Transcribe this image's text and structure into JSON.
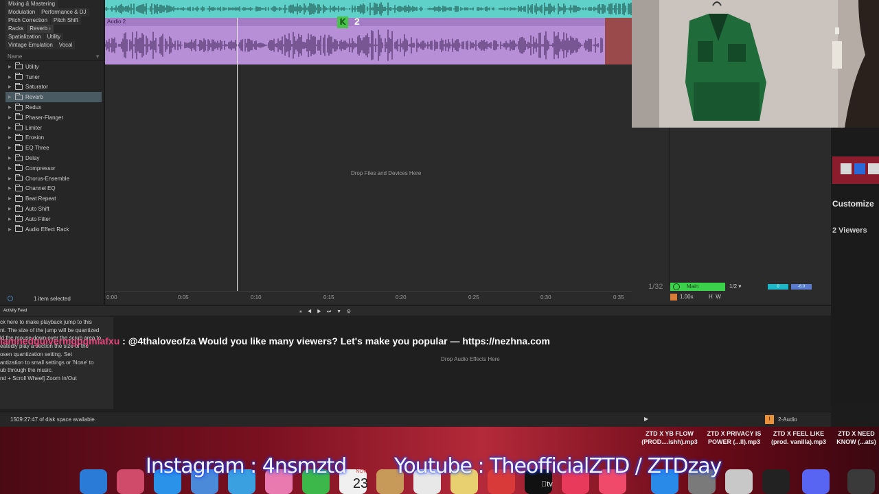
{
  "browser": {
    "tags": [
      [
        "Mixing & Mastering"
      ],
      [
        "Modulation",
        "Performance & DJ"
      ],
      [
        "Pitch Correction",
        "Pitch Shift"
      ],
      [
        "Racks",
        "Reverb ›"
      ],
      [
        "Spatialization",
        "Utility"
      ],
      [
        "Vintage Emulation",
        "Vocal"
      ]
    ],
    "name_header": "Name",
    "items": [
      "Utility",
      "Tuner",
      "Saturator",
      "Reverb",
      "Redux",
      "Phaser-Flanger",
      "Limiter",
      "Erosion",
      "EQ Three",
      "Delay",
      "Compressor",
      "Chorus-Ensemble",
      "Channel EQ",
      "Beat Repeat",
      "Auto Shift",
      "Auto Filter",
      "Audio Effect Rack"
    ],
    "selected_index": 3,
    "status": "1 item selected"
  },
  "arrangement": {
    "clip2_label": "Audio 2",
    "drop_text": "Drop Files and Devices Here",
    "ruler": [
      "0:00",
      "0:05",
      "0:10",
      "0:15",
      "0:20",
      "0:25",
      "0:30",
      "0:35"
    ],
    "badge_letter": "K",
    "badge_number": "2",
    "track1_color": "#5fd1c8",
    "clip2_color": "#b68fd6"
  },
  "stream": {
    "customize": "Customize",
    "viewers": "2 Viewers"
  },
  "transport": {
    "fraction": "1/32",
    "main_label": "Main",
    "quantize": "1/2",
    "level_a": "0",
    "level_b": "-6.0",
    "speed": "1.00x",
    "h": "H",
    "w": "W"
  },
  "detail": {
    "activity_title": "Activity Feed",
    "ctrl_icons": "⏸ ◀ ▶ ⏭ ▼ ⚙",
    "info_lines": [
      "ck here to make playback jump to this",
      "nt. The size of the jump will be quantized",
      "",
      "ld the mouse down over the scrub area to",
      "eatedly play a section the size of the",
      "osen quantization setting. Set",
      "antization to small settings or 'None' to",
      "ub through the music.",
      "",
      "nd + Scroll Wheel] Zoom In/Out"
    ],
    "chat_user": "iamnedguivermgpqmlafxu",
    "chat_message": " : @4thaloveofza Would you like many viewers? Let's make you popular — https://nezhna.com",
    "drop_fx": "Drop Audio Effects Here"
  },
  "statusbar": {
    "disk": "1509:27:47 of disk space available.",
    "play": "▶",
    "warn": "!",
    "track": "2-Audio"
  },
  "desktop": {
    "files": [
      {
        "line1": "ZTD X YB FLOW",
        "line2": "(PROD....ishh).mp3"
      },
      {
        "line1": "ZTD X PRIVACY IS",
        "line2": "POWER (...ll).mp3"
      },
      {
        "line1": "ZTD X FEEL LIKE",
        "line2": "(prod. vanilla).mp3"
      },
      {
        "line1": "ZTD X NEED",
        "line2": "KNOW (...ats)"
      }
    ],
    "overlay_instagram": "Instagram : 4nsmztd",
    "overlay_youtube": "Youtube : TheofficialZTD / ZTDzay",
    "calendar_month": "NOV",
    "calendar_day": "23",
    "tv_label": "tv"
  }
}
